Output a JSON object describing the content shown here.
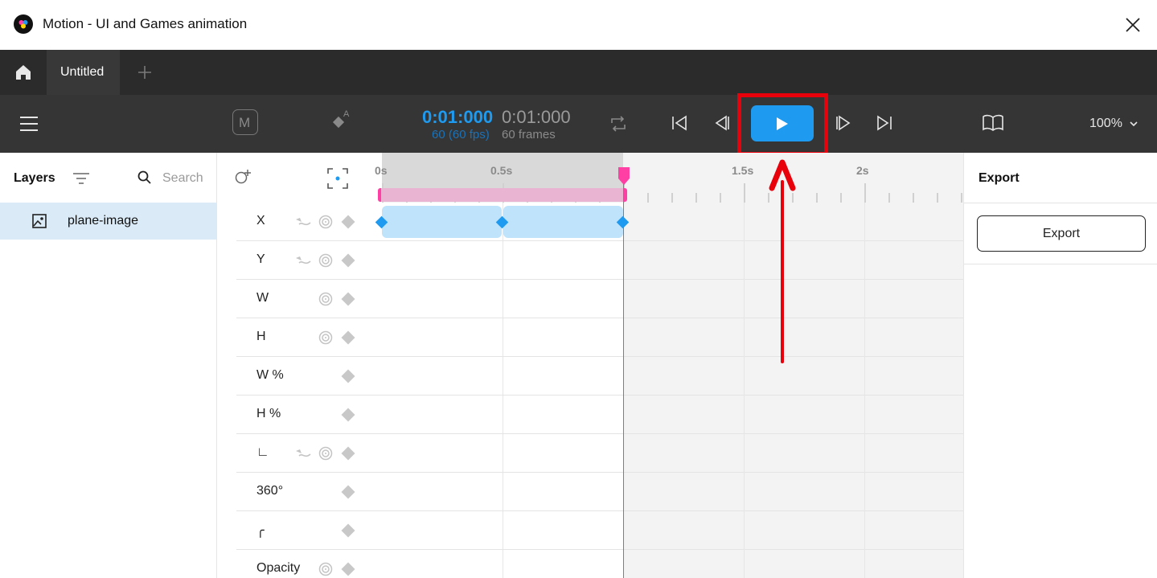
{
  "window": {
    "title": "Motion - UI and Games animation"
  },
  "tabs": {
    "active_label": "Untitled"
  },
  "toolbar": {
    "logo_letter": "M",
    "current_time": "0:01:000",
    "current_frame_info": "60 (60 fps)",
    "duration": "0:01:000",
    "duration_frames": "60 frames",
    "zoom": "100%"
  },
  "layers_panel": {
    "title": "Layers",
    "search_placeholder": "Search",
    "items": [
      {
        "label": "plane-image"
      }
    ]
  },
  "timeline": {
    "ruler_labels": [
      "0s",
      "0.5s",
      "1.5s",
      "2s"
    ],
    "properties": [
      "X",
      "Y",
      "W",
      "H",
      "W %",
      "H %",
      "∟",
      "360°",
      "╭",
      "Opacity"
    ]
  },
  "export_panel": {
    "title": "Export",
    "button_label": "Export"
  },
  "colors": {
    "accent_blue": "#1e9bf0",
    "playhead_pink": "#ff3fa4",
    "highlight_red": "#e8000b",
    "keyframe_bar": "#bfe3fb",
    "toolbar_bg": "#353535"
  }
}
